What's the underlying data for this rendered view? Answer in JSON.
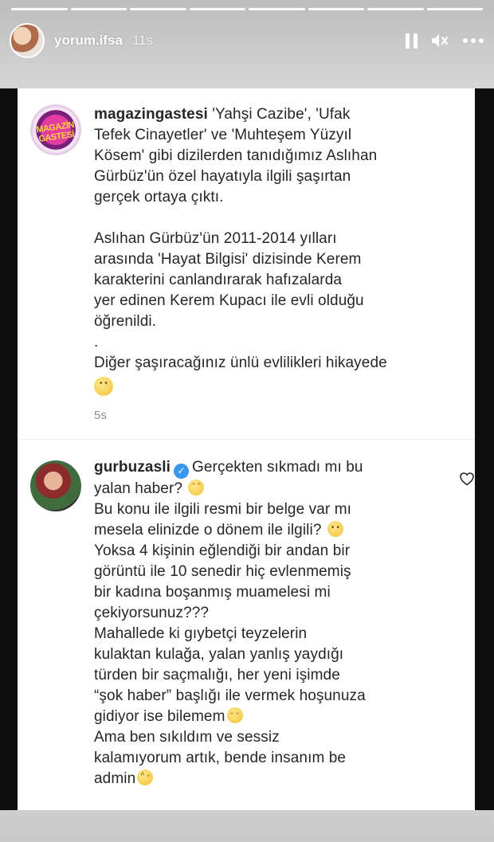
{
  "story": {
    "username": "yorum.ifsa",
    "time": "11s",
    "segments": 8
  },
  "comments": [
    {
      "username": "magazingastesi",
      "avatar_text": "MAGAZİN GASTESİ",
      "lines": [
        "'Yahşi Cazibe', 'Ufak",
        "Tefek Cinayetler' ve 'Muhteşem Yüzyıl",
        "Kösem' gibi dizilerden tanıdığımız Aslıhan",
        "Gürbüz'ün özel hayatıyla ilgili şaşırtan",
        "gerçek ortaya çıktı."
      ],
      "lines2": [
        "Aslıhan Gürbüz'ün 2011-2014 yılları",
        "arasında 'Hayat Bilgisi' dizisinde Kerem",
        "karakterini canlandırarak hafızalarda",
        "yer edinen Kerem Kupacı ile evli olduğu",
        "öğrenildi."
      ],
      "dot": ".",
      "line3": "Diğer şaşıracağınız ünlü evlilikleri hikayede",
      "time": "5s"
    },
    {
      "username": "gurbuzasli",
      "verified": true,
      "first": "Gerçekten sıkmadı mı bu",
      "lines": [
        "yalan haber?",
        "Bu konu ile ilgili resmi bir belge var mı",
        "mesela elinizde o dönem ile ilgili?",
        "Yoksa 4 kişinin eğlendiği bir andan bir",
        "görüntü ile 10 senedir hiç evlenmemiş",
        "bir kadına boşanmış muamelesi mi",
        "çekiyorsunuz???",
        "Mahallede ki gıybetçi teyzelerin",
        "kulaktan kulağa, yalan yanlış yaydığı",
        "türden  bir saçmalığı, her yeni işimde",
        "“şok haber” başlığı ile vermek hoşunuza",
        "gidiyor ise bilemem",
        "Ama ben sıkıldım ve sessiz",
        "kalamıyorum artık, bende insanım be",
        "admin"
      ]
    }
  ]
}
